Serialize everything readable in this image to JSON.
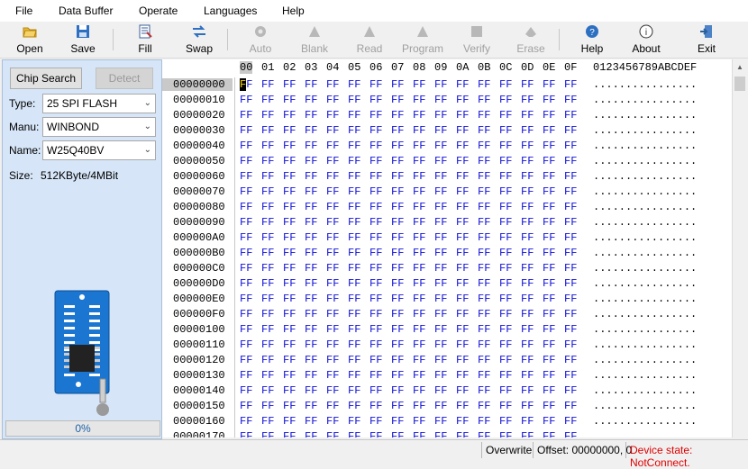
{
  "menu": [
    "File",
    "Data Buffer",
    "Operate",
    "Languages",
    "Help"
  ],
  "toolbar": [
    {
      "label": "Open",
      "icon": "folder-open-icon",
      "enabled": true
    },
    {
      "label": "Save",
      "icon": "floppy-disk-icon",
      "enabled": true
    },
    {
      "label": "Fill",
      "icon": "fill-document-icon",
      "enabled": true
    },
    {
      "label": "Swap",
      "icon": "swap-arrows-icon",
      "enabled": true
    },
    {
      "label": "Auto",
      "icon": "auto-gear-icon",
      "enabled": false
    },
    {
      "label": "Blank",
      "icon": "blank-check-icon",
      "enabled": false
    },
    {
      "label": "Read",
      "icon": "read-chip-icon",
      "enabled": false
    },
    {
      "label": "Program",
      "icon": "program-chip-icon",
      "enabled": false
    },
    {
      "label": "Verify",
      "icon": "verify-icon",
      "enabled": false
    },
    {
      "label": "Erase",
      "icon": "erase-icon",
      "enabled": false
    },
    {
      "label": "Help",
      "icon": "help-circle-icon",
      "enabled": true
    },
    {
      "label": "About",
      "icon": "info-circle-icon",
      "enabled": true
    },
    {
      "label": "Exit",
      "icon": "exit-door-icon",
      "enabled": true
    }
  ],
  "panel": {
    "chip_search": "Chip Search",
    "detect": "Detect",
    "type_label": "Type:",
    "type_value": "25 SPI FLASH",
    "manu_label": "Manu:",
    "manu_value": "WINBOND",
    "name_label": "Name:",
    "name_value": "W25Q40BV",
    "size_label": "Size:",
    "size_value": "512KByte/4MBit",
    "progress_value": 0,
    "progress_text": "0%"
  },
  "hex": {
    "columns": [
      "00",
      "01",
      "02",
      "03",
      "04",
      "05",
      "06",
      "07",
      "08",
      "09",
      "0A",
      "0B",
      "0C",
      "0D",
      "0E",
      "0F"
    ],
    "ascii_header": "0123456789ABCDEF",
    "addresses": [
      "00000000",
      "00000010",
      "00000020",
      "00000030",
      "00000040",
      "00000050",
      "00000060",
      "00000070",
      "00000080",
      "00000090",
      "000000A0",
      "000000B0",
      "000000C0",
      "000000D0",
      "000000E0",
      "000000F0",
      "00000100",
      "00000110",
      "00000120",
      "00000130",
      "00000140",
      "00000150",
      "00000160",
      "00000170"
    ],
    "byte": "FF",
    "ascii_row": "................"
  },
  "status": {
    "mode": "Overwrite",
    "offset": "Offset: 00000000, 0",
    "device": "Device state: NotConnect.",
    "device_color": "#e00000"
  },
  "colors": {
    "hex_value": "#1010d8",
    "panel_bg": "#d6e5f7",
    "progress_text": "#1e62a8"
  }
}
